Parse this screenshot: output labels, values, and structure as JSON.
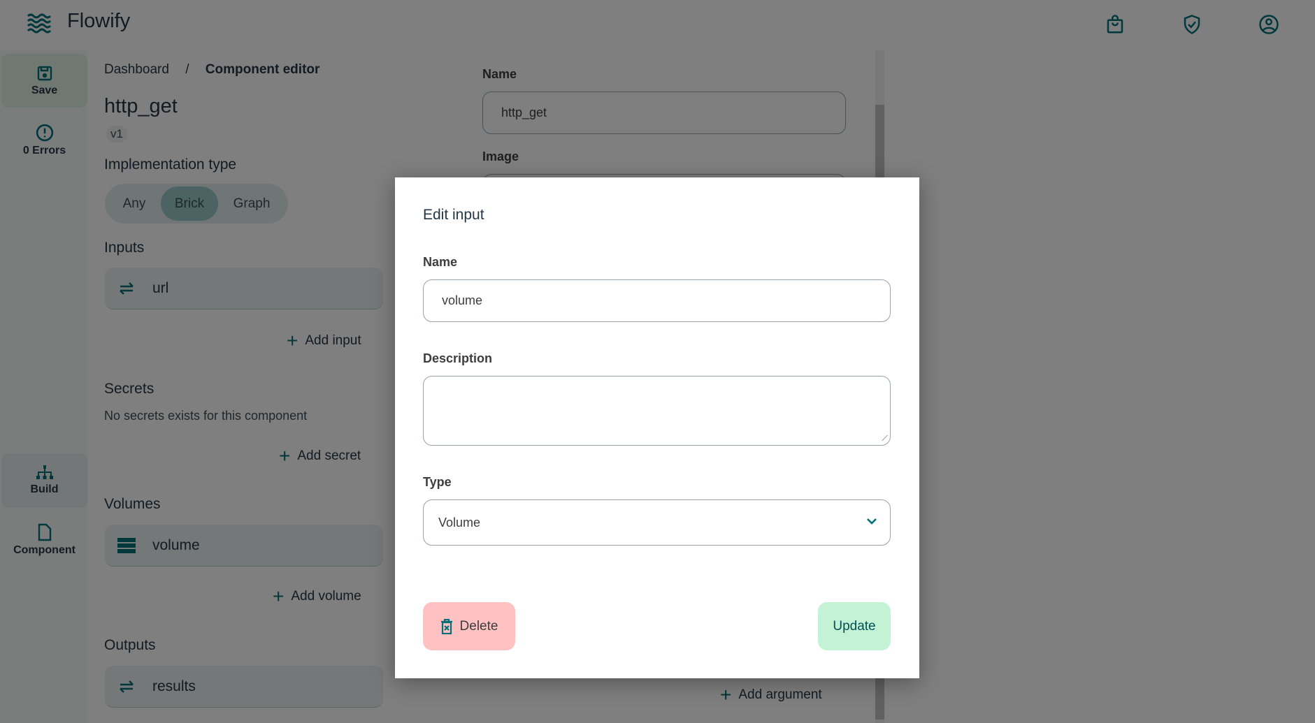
{
  "app": {
    "title": "Flowify",
    "icons": [
      "waves-logo-icon",
      "shopping-bag-icon",
      "shield-check-icon",
      "user-circle-icon"
    ],
    "accent": "#007079"
  },
  "sidebar": {
    "items": [
      {
        "label": "Save",
        "icon": "save-icon"
      },
      {
        "label": "0 Errors",
        "icon": "error-icon"
      },
      {
        "label": "Build",
        "icon": "sitemap-icon"
      },
      {
        "label": "Component",
        "icon": "file-icon"
      }
    ]
  },
  "breadcrumb": {
    "parent": "Dashboard",
    "sep": "/",
    "current": "Component editor"
  },
  "component": {
    "name": "http_get",
    "version": "v1"
  },
  "implementation": {
    "label": "Implementation type",
    "options": [
      "Any",
      "Brick",
      "Graph"
    ],
    "selected": "Brick"
  },
  "inputs": {
    "label": "Inputs",
    "items": [
      "url"
    ],
    "add": "Add input"
  },
  "secrets": {
    "label": "Secrets",
    "empty": "No secrets exists for this component",
    "add": "Add secret"
  },
  "volumes": {
    "label": "Volumes",
    "items": [
      "volume"
    ],
    "add": "Add volume"
  },
  "outputs": {
    "label": "Outputs",
    "items": [
      "results"
    ]
  },
  "right": {
    "name_label": "Name",
    "name_value": "http_get",
    "image_label": "Image",
    "add_argument": "Add argument"
  },
  "modal": {
    "title": "Edit input",
    "name_label": "Name",
    "name_value": "volume",
    "description_label": "Description",
    "description_value": "",
    "type_label": "Type",
    "type_value": "Volume",
    "delete": "Delete",
    "update": "Update",
    "delete_color": "#ffc1c1",
    "update_color": "#c3f3d4"
  }
}
